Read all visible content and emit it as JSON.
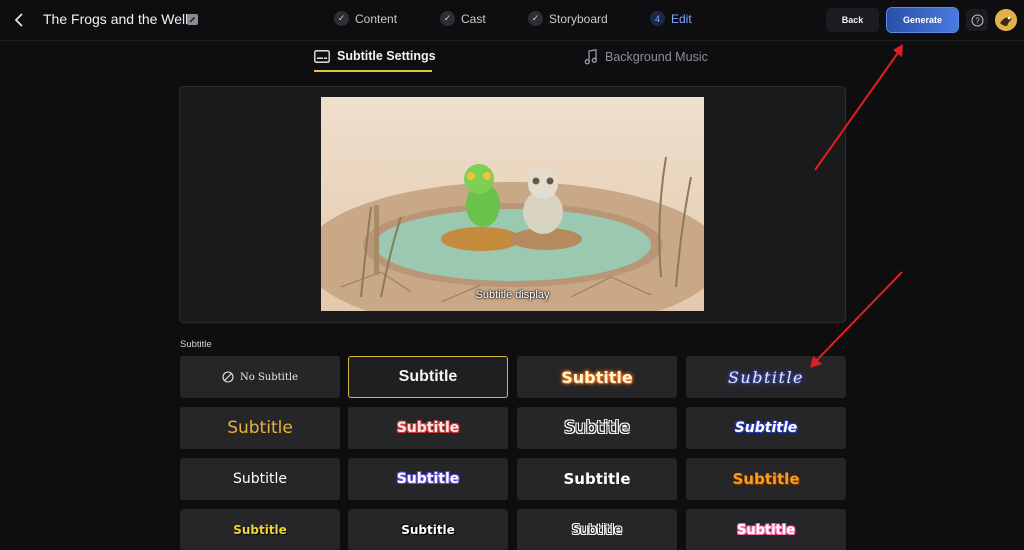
{
  "header": {
    "back_icon": "chevron-left-icon",
    "title": "The Frogs and the Well",
    "edit_icon": "pencil-square-icon",
    "steps": [
      {
        "label": "Content",
        "marker": "check",
        "active": false
      },
      {
        "label": "Cast",
        "marker": "check",
        "active": false
      },
      {
        "label": "Storyboard",
        "marker": "check",
        "active": false
      },
      {
        "label": "Edit",
        "marker": "4",
        "active": true
      }
    ],
    "back_button": "Back",
    "generate_button": "Generate",
    "help_icon": "question-circle-icon",
    "avatar_icon": "avatar-icon"
  },
  "tabs": {
    "subtitle": {
      "label": "Subtitle Settings",
      "icon": "subtitles-icon",
      "active": true
    },
    "music": {
      "label": "Background Music",
      "icon": "music-note-icon",
      "active": false
    }
  },
  "preview": {
    "subtitle_text": "Subtitle display"
  },
  "subtitle_section": {
    "label": "Subtitle",
    "no_subtitle_label": "No Subtitle",
    "styles": [
      {
        "text": "No Subtitle",
        "kind": "none"
      },
      {
        "text": "Subtitle",
        "kind": "plain-bold",
        "selected": true
      },
      {
        "text": "Subtitle",
        "kind": "orange-glow"
      },
      {
        "text": "Subtitle",
        "kind": "script-blue"
      },
      {
        "text": "Subtitle",
        "kind": "yellow-round"
      },
      {
        "text": "Subtitle",
        "kind": "red-outline"
      },
      {
        "text": "Subtitle",
        "kind": "white-outline"
      },
      {
        "text": "Subtitle",
        "kind": "blue-script-bold"
      },
      {
        "text": "Subtitle",
        "kind": "white-bold"
      },
      {
        "text": "Subtitle",
        "kind": "purple-outline"
      },
      {
        "text": "Subtitle",
        "kind": "white-heavy"
      },
      {
        "text": "Subtitle",
        "kind": "orange-heavy"
      },
      {
        "text": "Subtitle",
        "kind": "yellow-black"
      },
      {
        "text": "Subtitle",
        "kind": "white-black-outline"
      },
      {
        "text": "Subtitle",
        "kind": "black-white-outline"
      },
      {
        "text": "Subtitle",
        "kind": "pink-bubble"
      }
    ]
  },
  "colors": {
    "accent_gold": "#e6c53a",
    "generate_blue": "#3b64c8",
    "active_step": "#7fa8ff",
    "annotation_red": "#e02020"
  }
}
